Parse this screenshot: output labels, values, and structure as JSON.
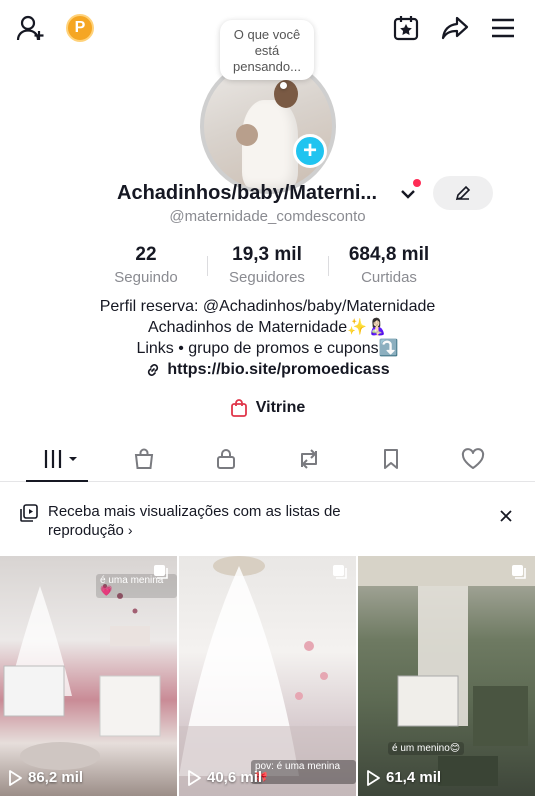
{
  "header": {
    "coin_label": "P"
  },
  "profile": {
    "bubble_text": "O que você está pensando...",
    "display_name": "Achadinhos/baby/Materni...",
    "username": "@maternidade_comdesconto"
  },
  "stats": [
    {
      "value": "22",
      "label": "Seguindo"
    },
    {
      "value": "19,3 mil",
      "label": "Seguidores"
    },
    {
      "value": "684,8 mil",
      "label": "Curtidas"
    }
  ],
  "bio": {
    "line1": "Perfil reserva: @Achadinhos/baby/Maternidade",
    "line2": "Achadinhos de Maternidade✨🤱🏻",
    "line3": "Links • grupo de promos e cupons⤵️",
    "link": "https://bio.site/promoedicass"
  },
  "vitrine_label": "Vitrine",
  "banner": {
    "text": "Receba mais visualizações com as listas de reprodução",
    "chevron": "›"
  },
  "videos": [
    {
      "views": "86,2 mil",
      "caption": "é uma menina💗"
    },
    {
      "views": "40,6 mil",
      "caption": "pov: é uma menina🎀"
    },
    {
      "views": "61,4 mil",
      "caption": "é um menino😊"
    }
  ],
  "colors": {
    "accent_blue": "#20c4f0",
    "notification_red": "#fe2c55",
    "coin_orange": "#f5a623",
    "vitrine_red": "#e0364a",
    "secondary_text": "#8a8b91"
  },
  "icons": [
    "add-friend-icon",
    "coin-icon",
    "calendar-star-icon",
    "share-icon",
    "menu-icon",
    "pencil-icon",
    "shopping-bag-icon",
    "link-icon",
    "grid-icon",
    "lock-icon",
    "repost-icon",
    "bookmark-icon",
    "heart-icon",
    "playlist-icon",
    "close-icon",
    "play-icon",
    "multi-photo-icon"
  ]
}
